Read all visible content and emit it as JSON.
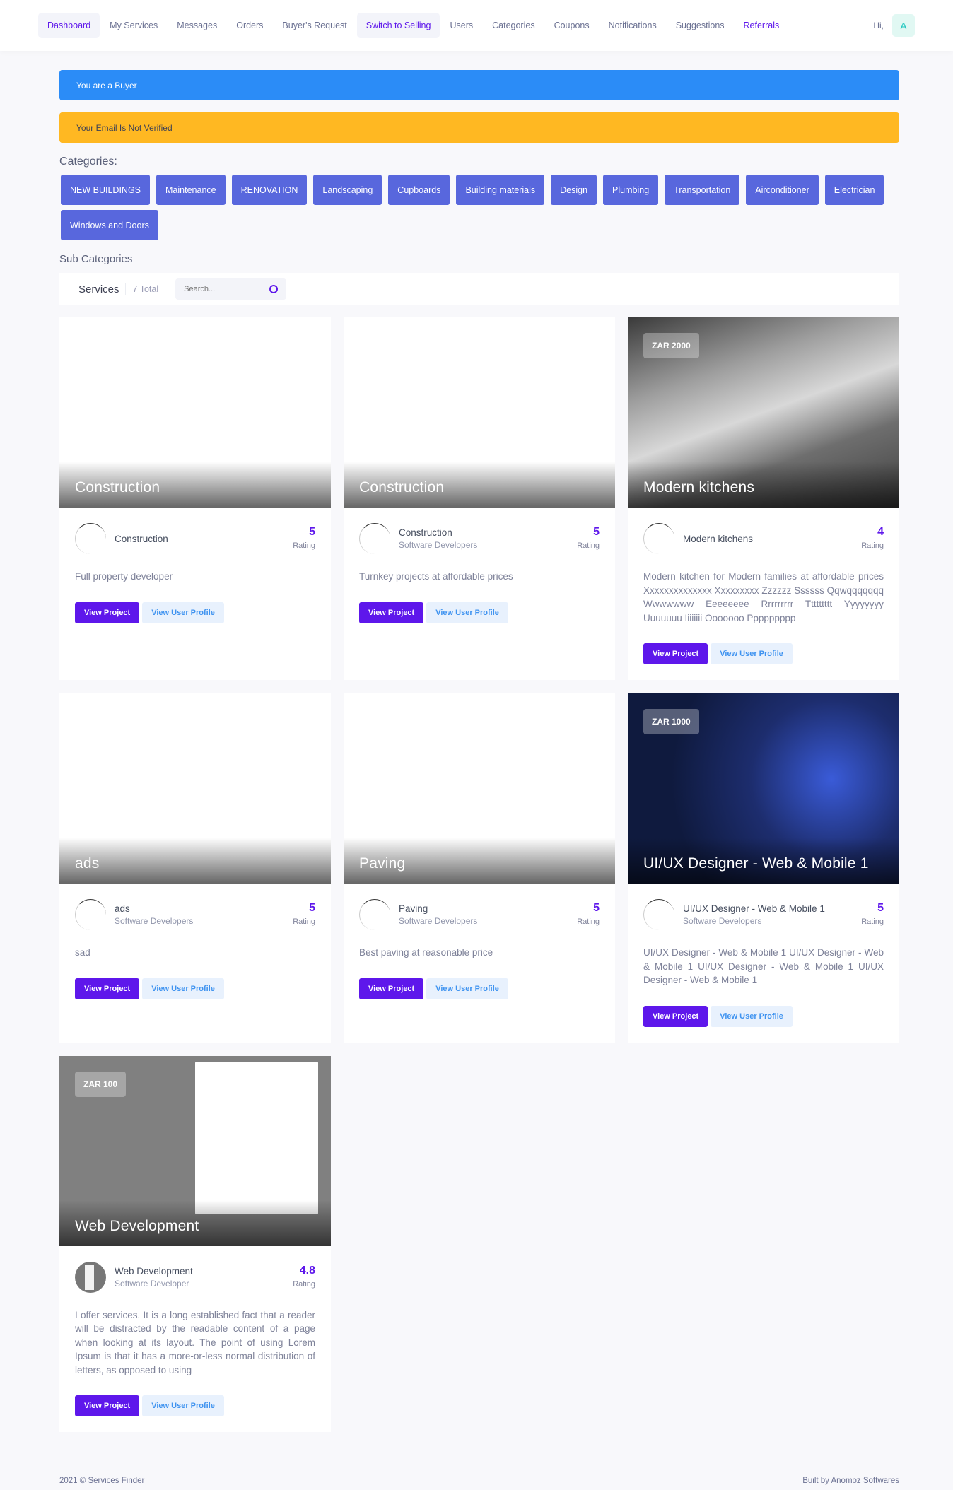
{
  "nav": {
    "items": [
      "Dashboard",
      "My Services",
      "Messages",
      "Orders",
      "Buyer's Request",
      "Switch to Selling",
      "Users",
      "Categories",
      "Coupons",
      "Notifications",
      "Suggestions",
      "Referrals"
    ],
    "greeting": "Hi,",
    "avatar_letter": "A"
  },
  "alerts": {
    "buyer": "You are a Buyer",
    "email": "Your Email Is Not Verified"
  },
  "categories_label": "Categories:",
  "categories": [
    "NEW BUILDINGS",
    "Maintenance",
    "RENOVATION",
    "Landscaping",
    "Cupboards",
    "Building materials",
    "Design",
    "Plumbing",
    "Transportation",
    "Airconditioner",
    "Electrician",
    "Windows and Doors"
  ],
  "sub_categories_label": "Sub Categories",
  "services": {
    "title": "Services",
    "total": "7 Total",
    "search_placeholder": "Search..."
  },
  "rating_label": "Rating",
  "buttons": {
    "view_project": "View Project",
    "view_profile": "View User Profile"
  },
  "cards": [
    {
      "title": "Construction",
      "name": "Construction",
      "subtitle": "",
      "rating": "5",
      "description": "Full property developer"
    },
    {
      "title": "Construction",
      "name": "Construction",
      "subtitle": "Software Developers",
      "rating": "5",
      "description": "Turnkey projects at affordable prices"
    },
    {
      "title": "Modern kitchens",
      "price": "ZAR 2000",
      "name": "Modern kitchens",
      "subtitle": "",
      "rating": "4",
      "description": "Modern kitchen for Modern families at affordable prices Xxxxxxxxxxxxxx Xxxxxxxxx Zzzzzz Ssssss Qqwqqqqqqq Wwwwwww Eeeeeeee Rrrrrrrrr Ttttttttt Yyyyyyyy Uuuuuuu Iiiiiiii Ooooooo Ppppppppp"
    },
    {
      "title": "ads",
      "name": "ads",
      "subtitle": "Software Developers",
      "rating": "5",
      "description": "sad"
    },
    {
      "title": "Paving",
      "name": "Paving",
      "subtitle": "Software Developers",
      "rating": "5",
      "description": "Best paving at reasonable price"
    },
    {
      "title": "UI/UX Designer - Web & Mobile 1",
      "price": "ZAR 1000",
      "name": "UI/UX Designer - Web & Mobile 1",
      "subtitle": "Software Developers",
      "rating": "5",
      "description": "UI/UX Designer - Web & Mobile 1 UI/UX Designer - Web & Mobile 1 UI/UX Designer - Web & Mobile 1 UI/UX Designer - Web & Mobile 1"
    },
    {
      "title": "Web Development",
      "price": "ZAR 100",
      "name": "Web Development",
      "subtitle": "Software Developer",
      "rating": "4.8",
      "description": "I offer services. It is a long established fact that a reader will be distracted by the readable content of a page when looking at its layout. The point of using Lorem Ipsum is that it has a more-or-less normal distribution of letters, as opposed to using"
    }
  ],
  "footer": {
    "copyright": "2021 © Services Finder",
    "built_by": "Built by Anomoz Softwares"
  }
}
